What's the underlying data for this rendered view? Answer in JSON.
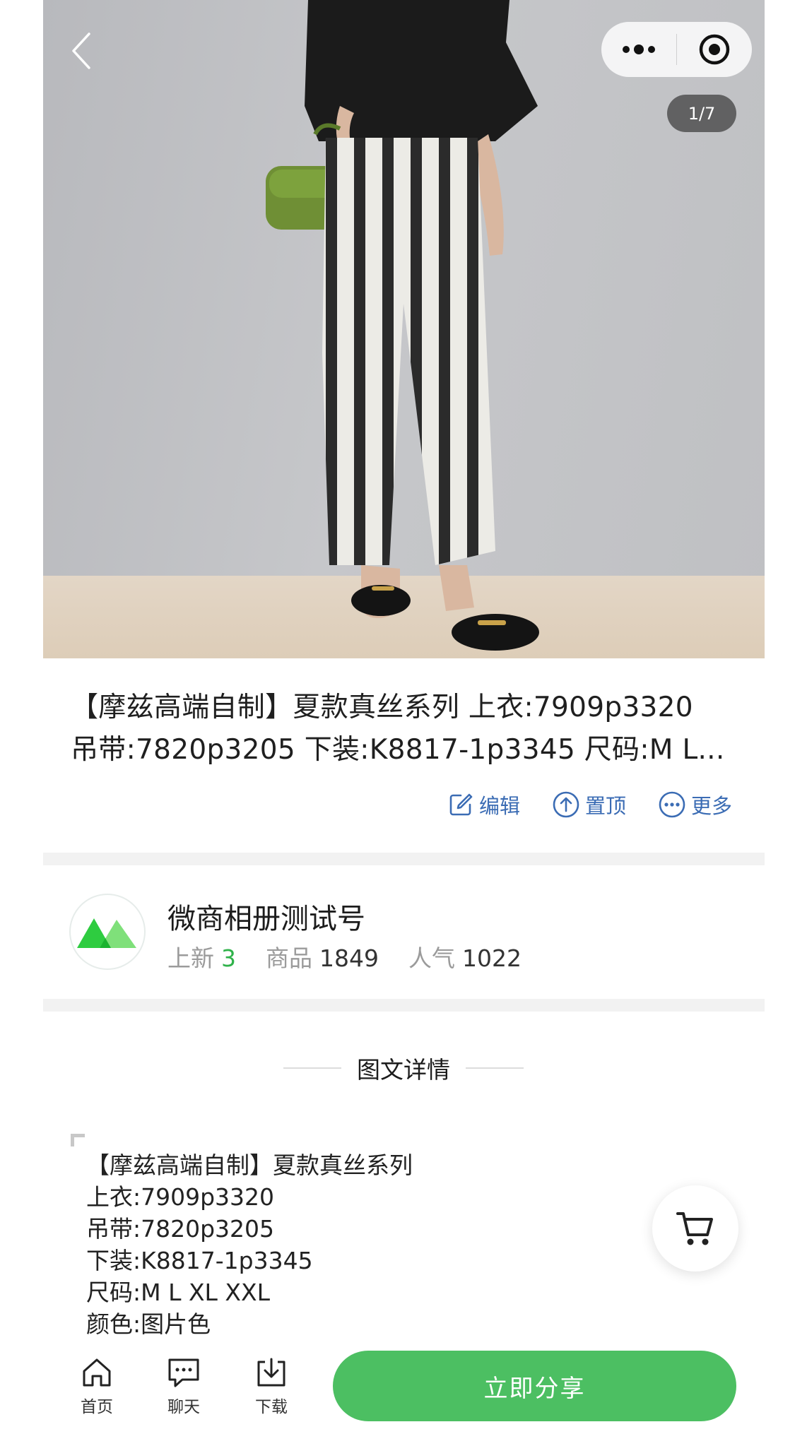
{
  "gallery": {
    "indicator": "1/7",
    "more_icon": "more-dots-icon",
    "close_icon": "target-circle-icon",
    "back_icon": "chevron-left-icon"
  },
  "product": {
    "title_line1": "【摩兹高端自制】夏款真丝系列 上衣:7909p3320",
    "title_line2": "吊带:7820p3205 下装:K8817-1p3345 尺码:M L..."
  },
  "actions": [
    {
      "label": "编辑",
      "icon": "edit-icon"
    },
    {
      "label": "置顶",
      "icon": "pin-top-icon"
    },
    {
      "label": "更多",
      "icon": "more-circle-icon"
    }
  ],
  "shop": {
    "name": "微商相册测试号",
    "stats": [
      {
        "label": "上新",
        "value": "3"
      },
      {
        "label": "商品",
        "value": "1849"
      },
      {
        "label": "人气",
        "value": "1022"
      }
    ]
  },
  "detail": {
    "heading": "图文详情",
    "lines": [
      "【摩兹高端自制】夏款真丝系列",
      "上衣:7909p3320",
      "吊带:7820p3205",
      "下装:K8817-1p3345",
      "尺码:M L XL XXL",
      "颜色:图片色"
    ]
  },
  "bottom_nav": {
    "tabs": [
      {
        "label": "首页",
        "icon": "home-icon"
      },
      {
        "label": "聊天",
        "icon": "chat-icon"
      },
      {
        "label": "下载",
        "icon": "download-icon"
      }
    ],
    "share_label": "立即分享"
  },
  "colors": {
    "accent_green": "#4cbf62",
    "link_blue": "#3b6cb4",
    "stat_green": "#2fb24a"
  }
}
